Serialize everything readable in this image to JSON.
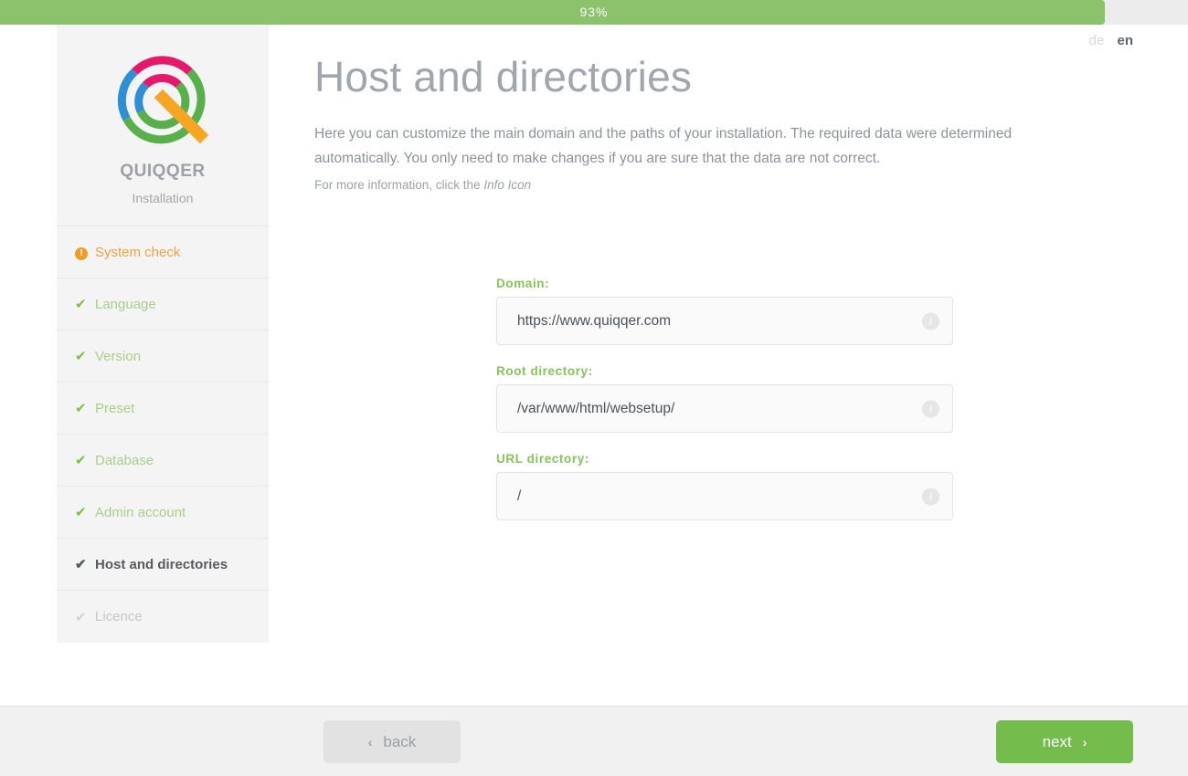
{
  "progress": {
    "percent_label": "93%",
    "percent_value": 93,
    "fill_color": "#8cc26b",
    "track_color": "#ececec"
  },
  "sidebar": {
    "brand_name": "QUIQQER",
    "brand_subtitle": "Installation",
    "logo_icon": "quiqqer-logo-icon",
    "items": [
      {
        "label": "System check",
        "icon": "warning-circle-icon",
        "state": "warn"
      },
      {
        "label": "Language",
        "icon": "check-icon",
        "state": "done"
      },
      {
        "label": "Version",
        "icon": "check-icon",
        "state": "done"
      },
      {
        "label": "Preset",
        "icon": "check-icon",
        "state": "done"
      },
      {
        "label": "Database",
        "icon": "check-icon",
        "state": "done"
      },
      {
        "label": "Admin account",
        "icon": "check-icon",
        "state": "done"
      },
      {
        "label": "Host and directories",
        "icon": "check-icon",
        "state": "active"
      },
      {
        "label": "Licence",
        "icon": "check-icon",
        "state": "disabled"
      }
    ]
  },
  "language_switcher": {
    "inactive": "de",
    "active": "en"
  },
  "main": {
    "title": "Host and directories",
    "lead": "Here you can customize the main domain and the paths of your installation. The required data were determined automatically. You only need to make changes if you are sure that the data are not correct.",
    "hint_prefix": "For more information, click the ",
    "hint_emphasis": "Info Icon"
  },
  "form": {
    "info_icon_glyph": "i",
    "fields": [
      {
        "label": "Domain:",
        "value": "https://www.quiqqer.com",
        "placeholder": ""
      },
      {
        "label": "Root directory:",
        "value": "/var/www/html/websetup/",
        "placeholder": ""
      },
      {
        "label": "URL directory:",
        "value": "/",
        "placeholder": ""
      }
    ]
  },
  "footer": {
    "back_label": "back",
    "back_chevron": "‹",
    "next_label": "next",
    "next_chevron": "›"
  },
  "colors": {
    "accent_green": "#74bd4d",
    "label_green": "#84c45a",
    "warn_orange": "#ef9c24",
    "sidebar_bg": "#f4f4f4"
  }
}
